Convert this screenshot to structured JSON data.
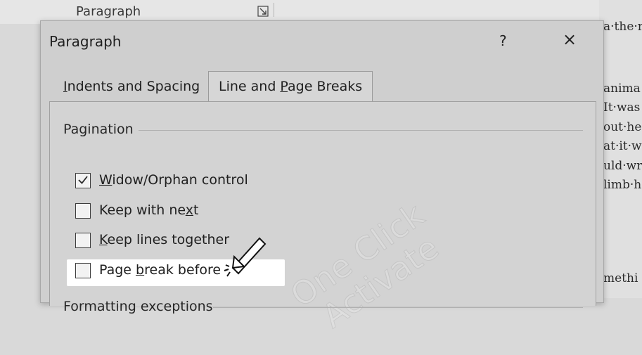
{
  "ribbon": {
    "group_label": "Paragraph",
    "launcher_icon": "dialog-launcher-icon"
  },
  "document": {
    "lines": [
      "a·the·r",
      "anima",
      "It·was",
      "out·he",
      "at·it·w",
      "uld·wr",
      "limb·h",
      "methi"
    ]
  },
  "dialog": {
    "title": "Paragraph",
    "help_label": "?",
    "close_label": "×",
    "tabs": [
      {
        "label_pre": "",
        "label_u": "I",
        "label_post": "ndents and Spacing",
        "active": false
      },
      {
        "label_pre": "Line and ",
        "label_u": "P",
        "label_post": "age Breaks",
        "active": true
      }
    ],
    "pagination": {
      "title": "Pagination",
      "options": [
        {
          "pre": "",
          "u": "W",
          "post": "idow/Orphan control",
          "checked": true
        },
        {
          "pre": "Keep with ne",
          "u": "x",
          "post": "t",
          "checked": false
        },
        {
          "pre": "",
          "u": "K",
          "post": "eep lines together",
          "checked": false
        },
        {
          "pre": "Page ",
          "u": "b",
          "post": "reak before",
          "checked": false,
          "highlighted": true
        }
      ]
    },
    "formatting": {
      "title": "Formatting exceptions"
    }
  },
  "watermark": {
    "line1": "One Click",
    "line2": "Activate"
  },
  "colors": {
    "dialog_bg": "#cfcfcf",
    "highlight": "#ffffff",
    "checkbox_border": "#3d3d3d"
  }
}
